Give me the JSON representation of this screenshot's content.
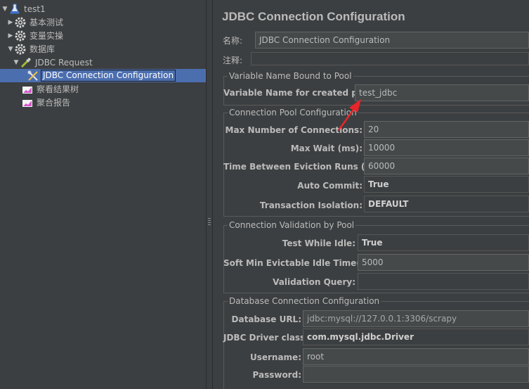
{
  "tree": {
    "items": [
      {
        "label": "test1"
      },
      {
        "label": "基本测试"
      },
      {
        "label": "变量实操"
      },
      {
        "label": "数据库"
      },
      {
        "label": "JDBC Request"
      },
      {
        "label": "JDBC Connection Configuration"
      },
      {
        "label": "察看结果树"
      },
      {
        "label": "聚合报告"
      }
    ]
  },
  "panel": {
    "title": "JDBC Connection Configuration",
    "name_label": "名称:",
    "name_value": "JDBC Connection Configuration",
    "comment_label": "注释:",
    "comment_value": "",
    "variable_group": {
      "title": "Variable Name Bound to Pool",
      "var_label": "Variable Name for created pool:",
      "var_value": "test_jdbc"
    },
    "pool_group": {
      "title": "Connection Pool Configuration",
      "max_conn_label": "Max Number of Connections:",
      "max_conn_value": "20",
      "max_wait_label": "Max Wait (ms):",
      "max_wait_value": "10000",
      "eviction_label": "Time Between Eviction Runs (ms):",
      "eviction_value": "60000",
      "auto_commit_label": "Auto Commit:",
      "auto_commit_value": "True",
      "isolation_label": "Transaction Isolation:",
      "isolation_value": "DEFAULT"
    },
    "validation_group": {
      "title": "Connection Validation by Pool",
      "test_idle_label": "Test While Idle:",
      "test_idle_value": "True",
      "soft_min_label": "Soft Min Evictable Idle Time(ms):",
      "soft_min_value": "5000",
      "query_label": "Validation Query:",
      "query_value": ""
    },
    "db_group": {
      "title": "Database Connection Configuration",
      "url_label": "Database URL:",
      "url_value": "jdbc:mysql://127.0.0.1:3306/scrapy",
      "driver_label": "JDBC Driver class:",
      "driver_value": "com.mysql.jdbc.Driver",
      "username_label": "Username:",
      "username_value": "root",
      "password_label": "Password:",
      "password_value": ""
    }
  },
  "colors": {
    "background": "#3c3f41",
    "selection": "#4b6eaf",
    "annotation_arrow": "#e8262a"
  }
}
